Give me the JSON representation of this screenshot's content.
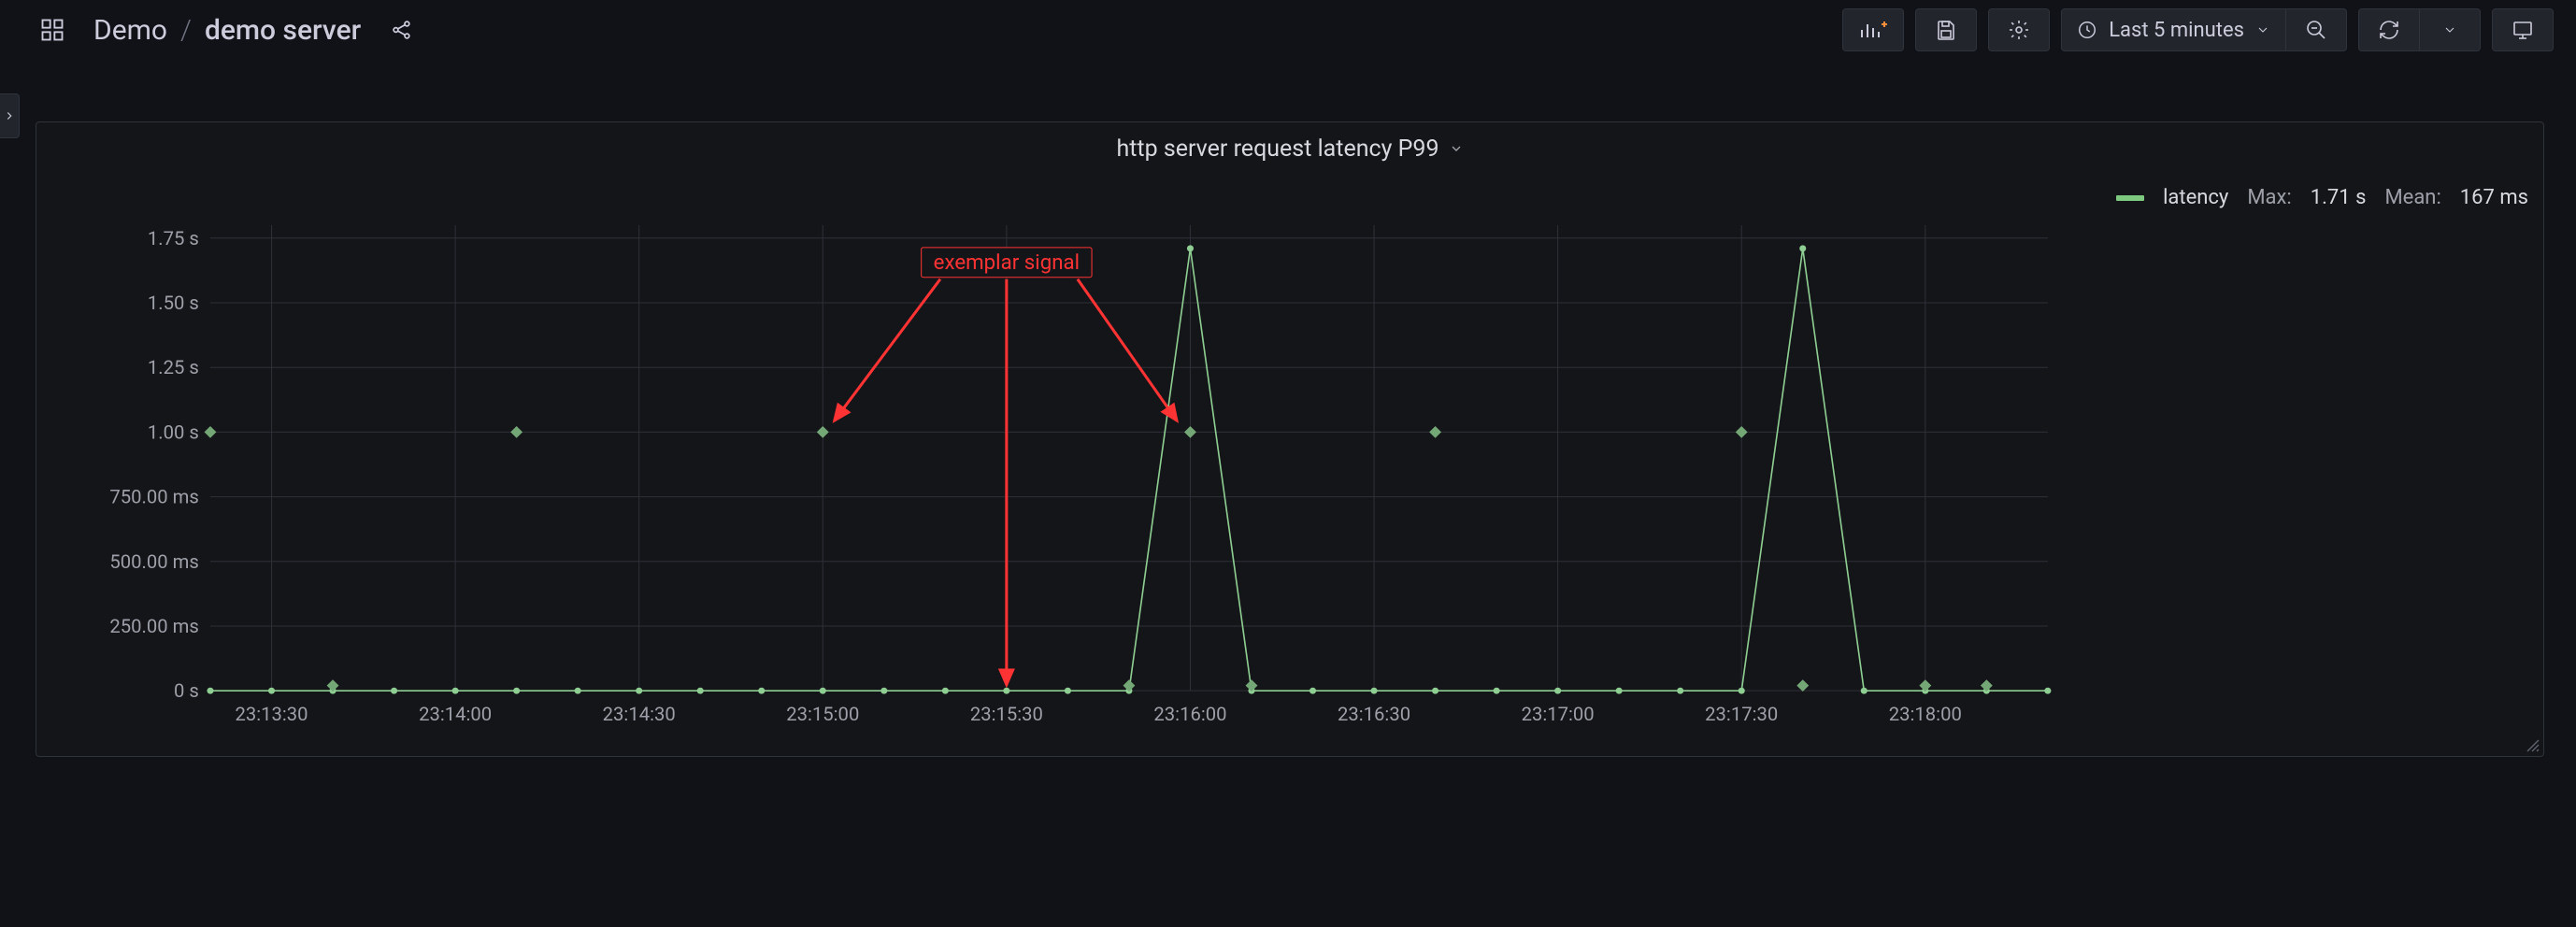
{
  "breadcrumb": {
    "folder": "Demo",
    "separator": "/",
    "dashboard": "demo server"
  },
  "time_picker": {
    "label": "Last 5 minutes"
  },
  "panel": {
    "title": "http server request latency P99"
  },
  "legend": {
    "series_name": "latency",
    "max_label": "Max:",
    "max_value": "1.71 s",
    "mean_label": "Mean:",
    "mean_value": "167 ms"
  },
  "annotation": {
    "label": "exemplar signal"
  },
  "chart_data": {
    "type": "line",
    "title": "http server request latency P99",
    "xlabel": "",
    "ylabel": "",
    "ylim": [
      0,
      1.8
    ],
    "y_ticks": [
      {
        "v": 0.0,
        "label": "0 s"
      },
      {
        "v": 0.25,
        "label": "250.00 ms"
      },
      {
        "v": 0.5,
        "label": "500.00 ms"
      },
      {
        "v": 0.75,
        "label": "750.00 ms"
      },
      {
        "v": 1.0,
        "label": "1.00 s"
      },
      {
        "v": 1.25,
        "label": "1.25 s"
      },
      {
        "v": 1.5,
        "label": "1.50 s"
      },
      {
        "v": 1.75,
        "label": "1.75 s"
      }
    ],
    "x_ticks": [
      {
        "t": 10,
        "label": "23:13:30"
      },
      {
        "t": 40,
        "label": "23:14:00"
      },
      {
        "t": 70,
        "label": "23:14:30"
      },
      {
        "t": 100,
        "label": "23:15:00"
      },
      {
        "t": 130,
        "label": "23:15:30"
      },
      {
        "t": 160,
        "label": "23:16:00"
      },
      {
        "t": 190,
        "label": "23:16:30"
      },
      {
        "t": 220,
        "label": "23:17:00"
      },
      {
        "t": 250,
        "label": "23:17:30"
      },
      {
        "t": 280,
        "label": "23:18:00"
      }
    ],
    "series": [
      {
        "name": "latency",
        "x": [
          0,
          10,
          20,
          30,
          40,
          50,
          60,
          70,
          80,
          90,
          100,
          110,
          120,
          130,
          140,
          150,
          160,
          170,
          180,
          190,
          200,
          210,
          220,
          230,
          240,
          250,
          260,
          270,
          280,
          290,
          300
        ],
        "values": [
          0,
          0,
          0,
          0,
          0,
          0,
          0,
          0,
          0,
          0,
          0,
          0,
          0,
          0,
          0,
          0,
          1.71,
          0,
          0,
          0,
          0,
          0,
          0,
          0,
          0,
          0,
          1.71,
          0,
          0,
          0,
          0
        ]
      }
    ],
    "exemplars_x": [
      0,
      20,
      50,
      100,
      150,
      160,
      170,
      200,
      250,
      260,
      280,
      290
    ],
    "exemplars_y": [
      1.0,
      0.02,
      1.0,
      1.0,
      0.02,
      1.0,
      0.02,
      1.0,
      1.0,
      0.02,
      0.02,
      0.02
    ]
  }
}
